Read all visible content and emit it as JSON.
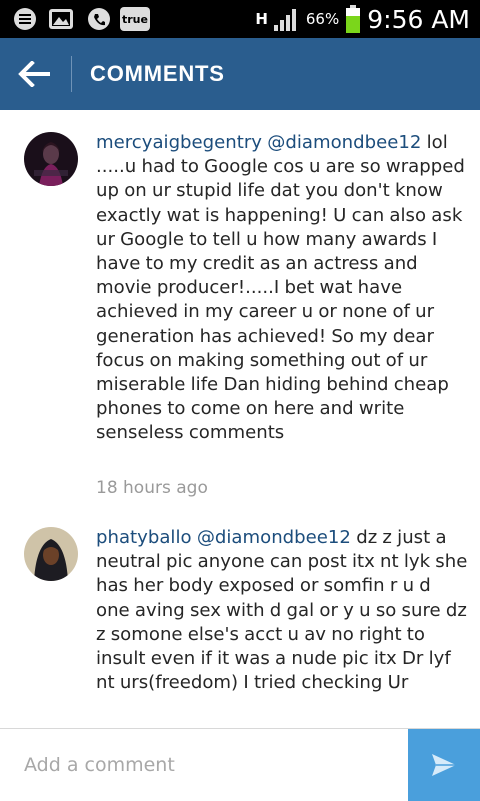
{
  "status_bar": {
    "carrier_badge": "true",
    "network": "H",
    "battery": "66%",
    "time": "9:56 AM"
  },
  "header": {
    "title": "COMMENTS"
  },
  "comments": [
    {
      "username": "mercyaigbegentry",
      "mention": "@diamondbee12",
      "text": "lol .....u had to Google cos u are so wrapped up on ur stupid life dat you don't know exactly wat is happening!  U can also ask ur Google to tell u how many awards I have to my credit as an actress and movie producer!.....I bet wat have achieved in my career u or none of ur generation has achieved!  So my dear focus on making something out of ur miserable life Dan hiding behind cheap phones to come on here and write senseless comments",
      "time": "18 hours ago"
    },
    {
      "username": "phatyballo",
      "mention": "@diamondbee12",
      "text": " dz z just a neutral pic anyone can post itx nt lyk she has her body exposed or somfin  r u d one aving sex with d gal or y u so sure  dz z somone else's acct  u av no right to insult even if it was a nude pic  itx Dr lyf  nt urs(freedom)  I tried checking Ur"
    }
  ],
  "composer": {
    "placeholder": "Add a comment"
  }
}
